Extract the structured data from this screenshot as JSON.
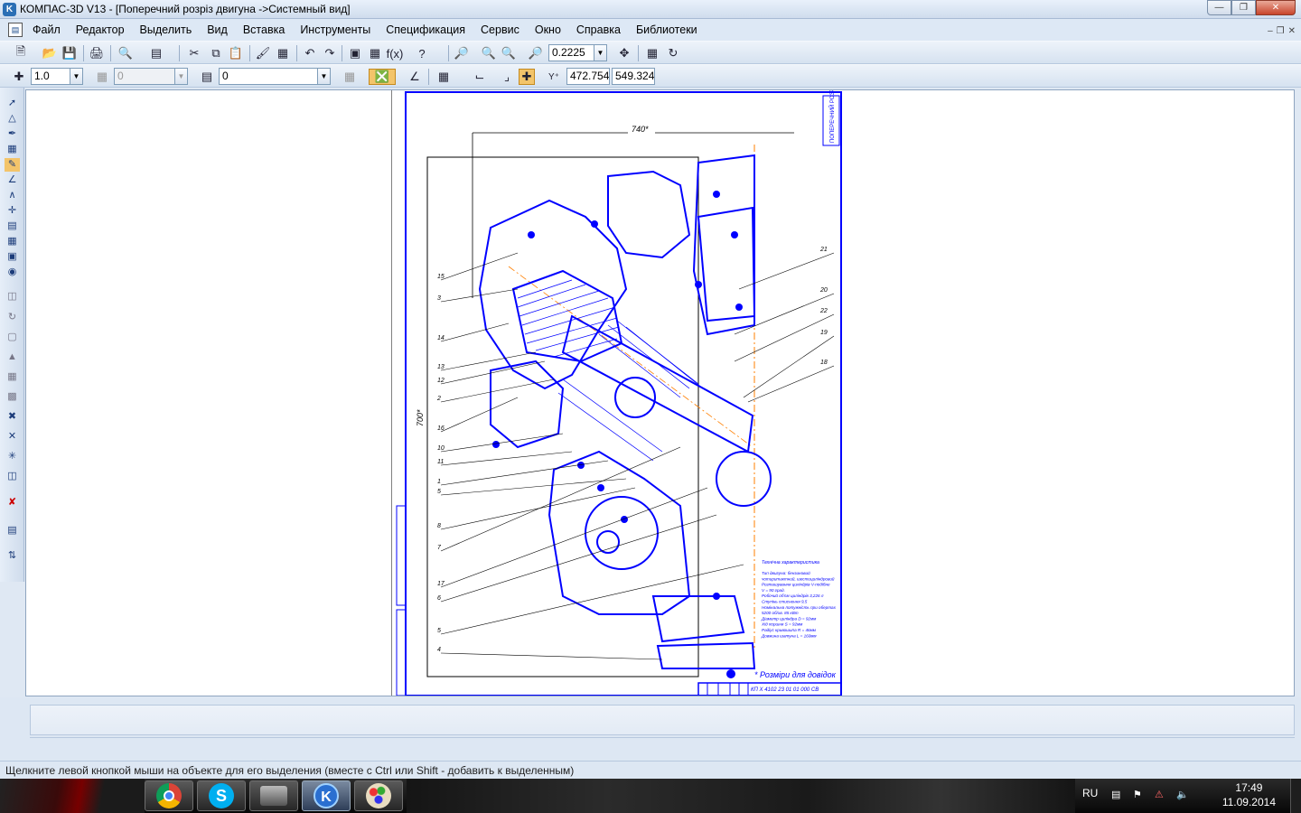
{
  "window": {
    "title": "КОМПАС-3D V13 - [Поперечний розріз  двигуна ->Системный вид]",
    "icon": "kompas-icon",
    "buttons": [
      "minimize-icon",
      "maximize-icon",
      "close-icon"
    ]
  },
  "menu": {
    "items": [
      "Файл",
      "Редактор",
      "Выделить",
      "Вид",
      "Вставка",
      "Инструменты",
      "Спецификация",
      "Сервис",
      "Окно",
      "Справка",
      "Библиотеки"
    ]
  },
  "toolbar1": {
    "zoom_value": "0.2225"
  },
  "toolbar2": {
    "step_value": "1.0",
    "layer_value": "0",
    "style_value": "0",
    "coord_x": "472.754",
    "coord_y": "549.324"
  },
  "drawing": {
    "dim_width": "740*",
    "dim_height": "700*",
    "callouts": [
      "15",
      "3",
      "14",
      "13",
      "12",
      "2",
      "16",
      "10",
      "11",
      "1",
      "5",
      "8",
      "7",
      "17",
      "6",
      "5",
      "4",
      "21",
      "20",
      "22",
      "19",
      "18"
    ],
    "stamp_code": "КП Х 4102 23 01 01 000 СВ",
    "tech_title": "Технічна характеристика",
    "tech_lines": [
      "Тип двигуна: бензиновий",
      "чотиритактний, шестициліндровий",
      "Розташування циліндрів V-подібне",
      "V = 90 град.",
      "Робочий об'єм циліндрів 3,226 л",
      "Ступінь стиснення 9,5",
      "Номінальна потужність при обертах",
      "5200 об/хв. 85 кВт",
      "Діаметр циліндра D = 92мм",
      "Хід поршня S = 92мм",
      "Радіус кривошипа R = 46мм",
      "Довжина шатуна L = 160мм"
    ],
    "footnote": "* Розміри для довідок",
    "side_label": "ПОПЕРЕЧНИЙ РОЗРІЗ"
  },
  "status": {
    "hint": "Щелкните левой кнопкой мыши на объекте для его выделения (вместе с Ctrl или Shift - добавить к выделенным)"
  },
  "taskbar": {
    "apps": [
      "chrome-icon",
      "skype-icon",
      "printer-icon",
      "kompas-icon",
      "paint-icon"
    ],
    "lang": "RU",
    "time": "17:49",
    "date": "11.09.2014"
  },
  "colors": {
    "drawing_line": "#0000ff",
    "axis_line": "#ff7f00",
    "frame": "#000000"
  }
}
